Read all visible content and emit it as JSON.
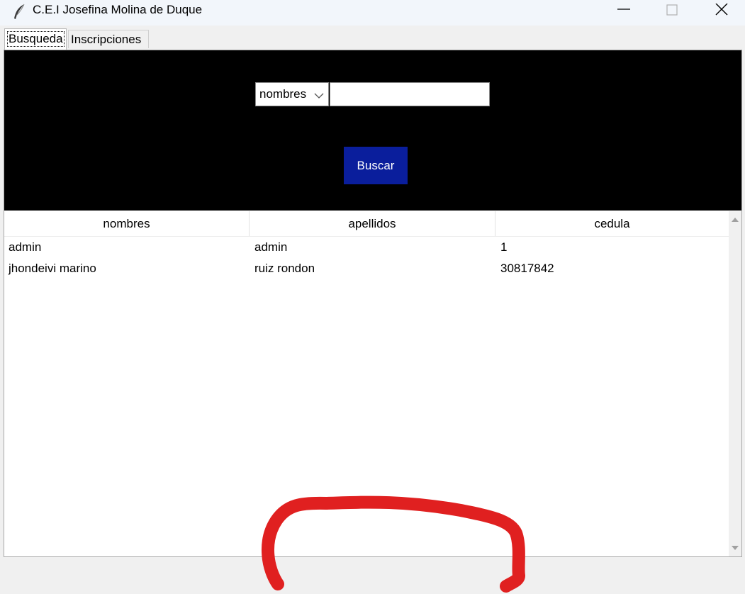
{
  "window": {
    "title": "C.E.I Josefina Molina de Duque"
  },
  "tabs": [
    {
      "label": "Busqueda",
      "active": true
    },
    {
      "label": "Inscripciones",
      "active": false
    }
  ],
  "search": {
    "field_selected": "nombres",
    "query_value": "",
    "button_label": "Buscar",
    "button_color": "#0a1e9c",
    "panel_color": "#000000"
  },
  "table": {
    "columns": [
      "nombres",
      "apellidos",
      "cedula"
    ],
    "rows": [
      [
        "admin",
        "admin",
        "1"
      ],
      [
        "jhondeivi marino",
        "ruiz rondon",
        "30817842"
      ]
    ]
  },
  "annotation_color": "#e02020"
}
